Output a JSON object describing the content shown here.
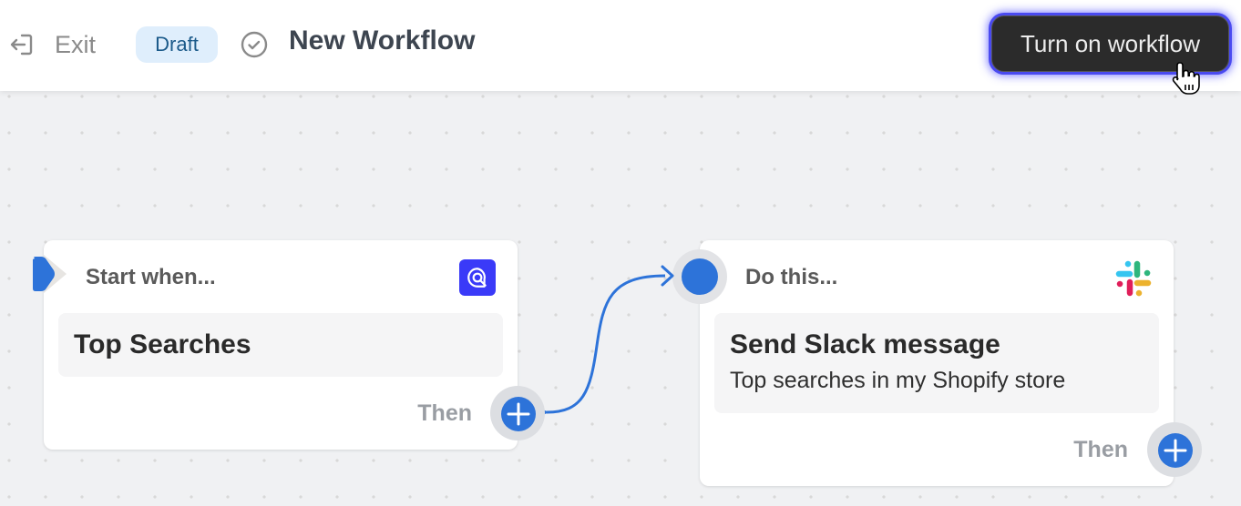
{
  "header": {
    "exit_label": "Exit",
    "status_badge": "Draft",
    "status_icon": "check-circle-icon",
    "title": "New Workflow",
    "primary_action": "Turn on workflow"
  },
  "canvas": {
    "background": "dotted-grid",
    "nodes": [
      {
        "id": "trigger",
        "header_label": "Start when...",
        "app_icon": "search-app-icon",
        "app_icon_color": "#3a3af8",
        "title": "Top Searches",
        "subtitle": "",
        "then_label": "Then"
      },
      {
        "id": "action",
        "header_label": "Do this...",
        "app_icon": "slack-icon",
        "title": "Send Slack message",
        "subtitle": "Top searches in my Shopify store",
        "then_label": "Then"
      }
    ],
    "connections": [
      {
        "from": "trigger",
        "to": "action"
      }
    ]
  },
  "colors": {
    "accent": "#2d73d9",
    "primary_button_bg": "#2b2b2b",
    "focus_ring": "#4a4af0",
    "draft_badge_bg": "#dfeefc",
    "draft_badge_text": "#1b5a8a",
    "canvas_bg": "#f0f1f3"
  }
}
